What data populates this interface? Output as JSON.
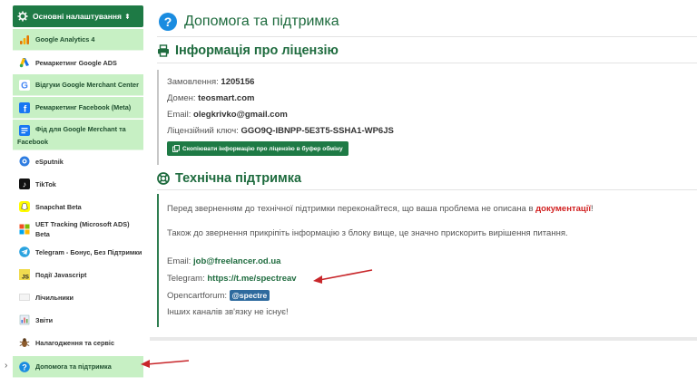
{
  "sidebar": {
    "header_label": "Основні налаштування",
    "items": [
      {
        "label": "Google Analytics 4",
        "icon": "google-analytics-icon"
      },
      {
        "label": "Ремаркетинг Google ADS",
        "icon": "google-ads-icon"
      },
      {
        "label": "Відгуки Google Merchant Center",
        "icon": "google-g-icon"
      },
      {
        "label": "Ремаркетинг Facebook (Meta)",
        "icon": "facebook-icon"
      },
      {
        "label": "Фід для Google Merchant та",
        "label2": "Facebook",
        "icon": "feed-icon"
      },
      {
        "label": "eSputnik",
        "icon": "esputnik-icon"
      },
      {
        "label": "TikTok",
        "icon": "tiktok-icon"
      },
      {
        "label": "Snapchat Beta",
        "icon": "snapchat-icon"
      },
      {
        "label": "UET Tracking (Microsoft ADS) Beta",
        "icon": "microsoft-icon"
      },
      {
        "label": "Telegram - Бонус, Без Підтримки",
        "icon": "telegram-icon"
      },
      {
        "label": "Події Javascript",
        "icon": "javascript-icon"
      },
      {
        "label": "Лічильники",
        "icon": "counter-icon"
      },
      {
        "label": "Звіти",
        "icon": "reports-icon"
      },
      {
        "label": "Налагодження та сервіс",
        "icon": "debug-bug-icon"
      },
      {
        "label": "Допомога та підтримка",
        "icon": "help-icon"
      }
    ]
  },
  "page": {
    "title": "Допомога та підтримка"
  },
  "license": {
    "title": "Інформація про ліцензію",
    "order_label": "Замовлення:",
    "order_value": "1205156",
    "domain_label": "Домен:",
    "domain_value": "teosmart.com",
    "email_label": "Email:",
    "email_value": "olegkrivko@gmail.com",
    "key_label": "Ліцензійний ключ:",
    "key_value": "GGO9Q-IBNPP-5E3T5-SSHA1-WP6JS",
    "copy_button": "Скопіювати інформацію про ліцензію в буфер обміну"
  },
  "support": {
    "title": "Технічна підтримка",
    "line1_before": "Перед зверненням до технічної підтримки переконайтеся, що ваша проблема не описана в",
    "line1_link": "документації",
    "line1_after": "!",
    "line2": "Також до звернення прикріпіть інформацію з блоку вище, це значно прискорить вирішення питання.",
    "email_label": "Email:",
    "email_value": "job@freelancer.od.ua",
    "telegram_label": "Telegram:",
    "telegram_value": "https://t.me/spectreav",
    "forum_label": "Opencartforum:",
    "forum_value": "@spectre",
    "no_other": "Інших каналів зв'язку не існує!"
  },
  "colors": {
    "accent_green": "#1e7a45",
    "sidebar_item_bg": "#c7f0c4",
    "link_red": "#d11f1f",
    "annotation_arrow": "#c8262a"
  }
}
